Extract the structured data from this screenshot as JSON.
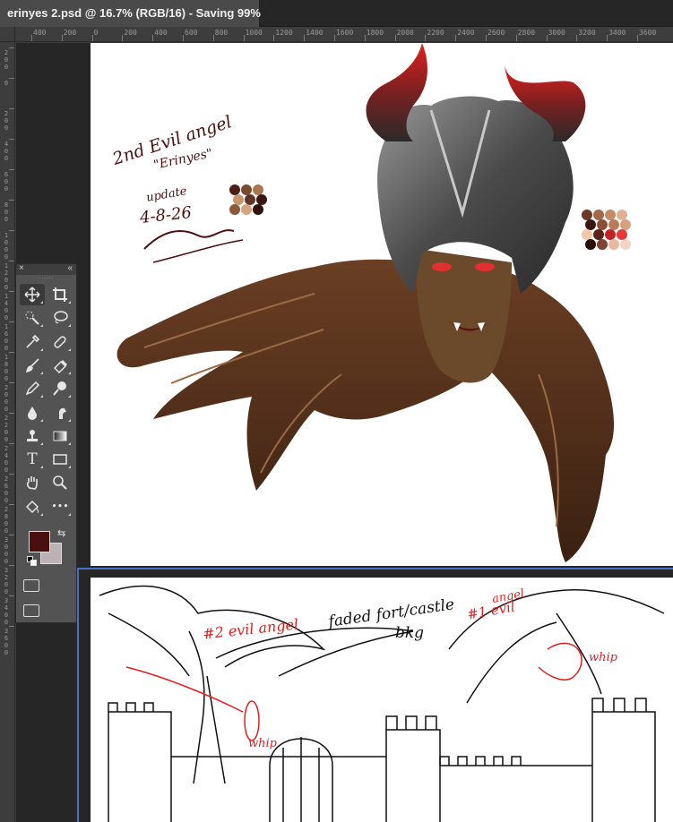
{
  "document_tab": {
    "title": "erinyes 2.psd @ 16.7% (RGB/16) - Saving 99%"
  },
  "ruler_horizontal": {
    "labels": [
      "400",
      "200",
      "0",
      "200",
      "400",
      "600",
      "800",
      "1000",
      "1200",
      "1400",
      "1600",
      "1800",
      "2000",
      "2200",
      "2400",
      "2600",
      "2800",
      "3000",
      "3200",
      "3400",
      "3600"
    ]
  },
  "ruler_vertical": {
    "labels": [
      "2\n0\n0",
      "0",
      "2\n0\n0",
      "4\n0\n0",
      "6\n0\n0",
      "8\n0\n0",
      "1\n0\n0\n0",
      "1\n2\n0\n0",
      "1\n4\n0\n0",
      "1\n6\n0\n0",
      "1\n8\n0\n0",
      "2\n0\n0\n0",
      "2\n2\n0\n0",
      "2\n4\n0\n0",
      "2\n6\n0\n0",
      "2\n8\n0\n0",
      "3\n0\n0\n0",
      "3\n2\n0\n0",
      "3\n4\n0\n0",
      "3\n6\n0\n0"
    ]
  },
  "artwork_top": {
    "notes": [
      "2nd Evil angel",
      "\"Erinyes\"",
      "update",
      "4-8-26"
    ],
    "palette_left": [
      "#4a1f16",
      "#7a4a2e",
      "#a87853",
      "#c8956d",
      "#5e3322",
      "#3a1812",
      "#8c5a3a",
      "#d4a47e",
      "#2e130e"
    ],
    "palette_right": [
      "#6b3a26",
      "#a0694a",
      "#c48a67",
      "#e0b090",
      "#3a1812",
      "#8a5036",
      "#b97b5b",
      "#d9a07e",
      "#f2c7a9",
      "#5a2218",
      "#c02424",
      "#e03a3a",
      "#2a0d0a",
      "#7e4230",
      "#e8b8a0",
      "#f4d5c5"
    ]
  },
  "artwork_bottom": {
    "notes": [
      "#2 evil angel",
      "faded fort/castle",
      "bkg",
      "#1 evil",
      "angel",
      "whip",
      "whip"
    ]
  },
  "tools_panel": {
    "tools": [
      {
        "name": "move-tool",
        "label": "Move Tool"
      },
      {
        "name": "crop-tool",
        "label": "Crop Tool"
      },
      {
        "name": "quick-selection-tool",
        "label": "Quick Selection Tool"
      },
      {
        "name": "lasso-tool",
        "label": "Lasso Tool"
      },
      {
        "name": "eyedropper-tool",
        "label": "Eyedropper Tool"
      },
      {
        "name": "healing-brush-tool",
        "label": "Healing Brush Tool"
      },
      {
        "name": "brush-tool",
        "label": "Brush Tool"
      },
      {
        "name": "eraser-tool",
        "label": "Eraser Tool"
      },
      {
        "name": "pencil-tool",
        "label": "Pencil Tool"
      },
      {
        "name": "dodge-tool",
        "label": "Dodge Tool"
      },
      {
        "name": "blur-tool",
        "label": "Blur Tool"
      },
      {
        "name": "smudge-tool",
        "label": "Smudge Tool"
      },
      {
        "name": "clone-stamp-tool",
        "label": "Clone Stamp Tool"
      },
      {
        "name": "gradient-tool",
        "label": "Gradient Tool"
      },
      {
        "name": "type-tool",
        "label": "Type Tool",
        "glyph": "T"
      },
      {
        "name": "rectangle-tool",
        "label": "Rectangle Tool"
      },
      {
        "name": "hand-tool",
        "label": "Hand Tool"
      },
      {
        "name": "zoom-tool",
        "label": "Zoom Tool"
      },
      {
        "name": "paint-bucket-tool",
        "label": "Paint Bucket Tool"
      },
      {
        "name": "edit-toolbar-tool",
        "label": "Edit Toolbar",
        "glyph": "•••"
      }
    ],
    "foreground_color": "#4a0f0f",
    "background_color": "#bdb1b4"
  },
  "colors": {
    "app_background": "#3b3b3b",
    "pasteboard": "#262626",
    "guide": "#4a6fc7",
    "accent_red": "#e02020"
  }
}
